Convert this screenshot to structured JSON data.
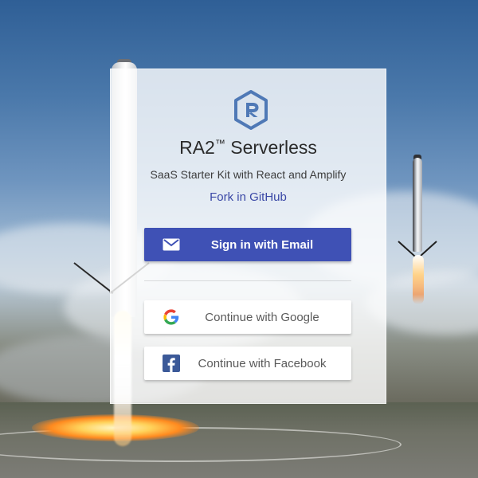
{
  "app": {
    "title": "RA2™ Serverless",
    "title_main": "RA2",
    "title_tm": "™",
    "title_rest": " Serverless",
    "subtitle": "SaaS Starter Kit with React and Amplify",
    "github_link": "Fork in GitHub"
  },
  "buttons": {
    "email_label": "Sign in with Email",
    "google_label": "Continue with Google",
    "facebook_label": "Continue with Facebook"
  },
  "icons": {
    "logo": "ra2-logo-icon",
    "email": "mail-icon",
    "google": "google-icon",
    "facebook": "facebook-icon"
  },
  "colors": {
    "primary": "#3f51b5",
    "link": "#3a48a6",
    "card_bg": "#ffffff",
    "logo_blue": "#4f79b6"
  }
}
